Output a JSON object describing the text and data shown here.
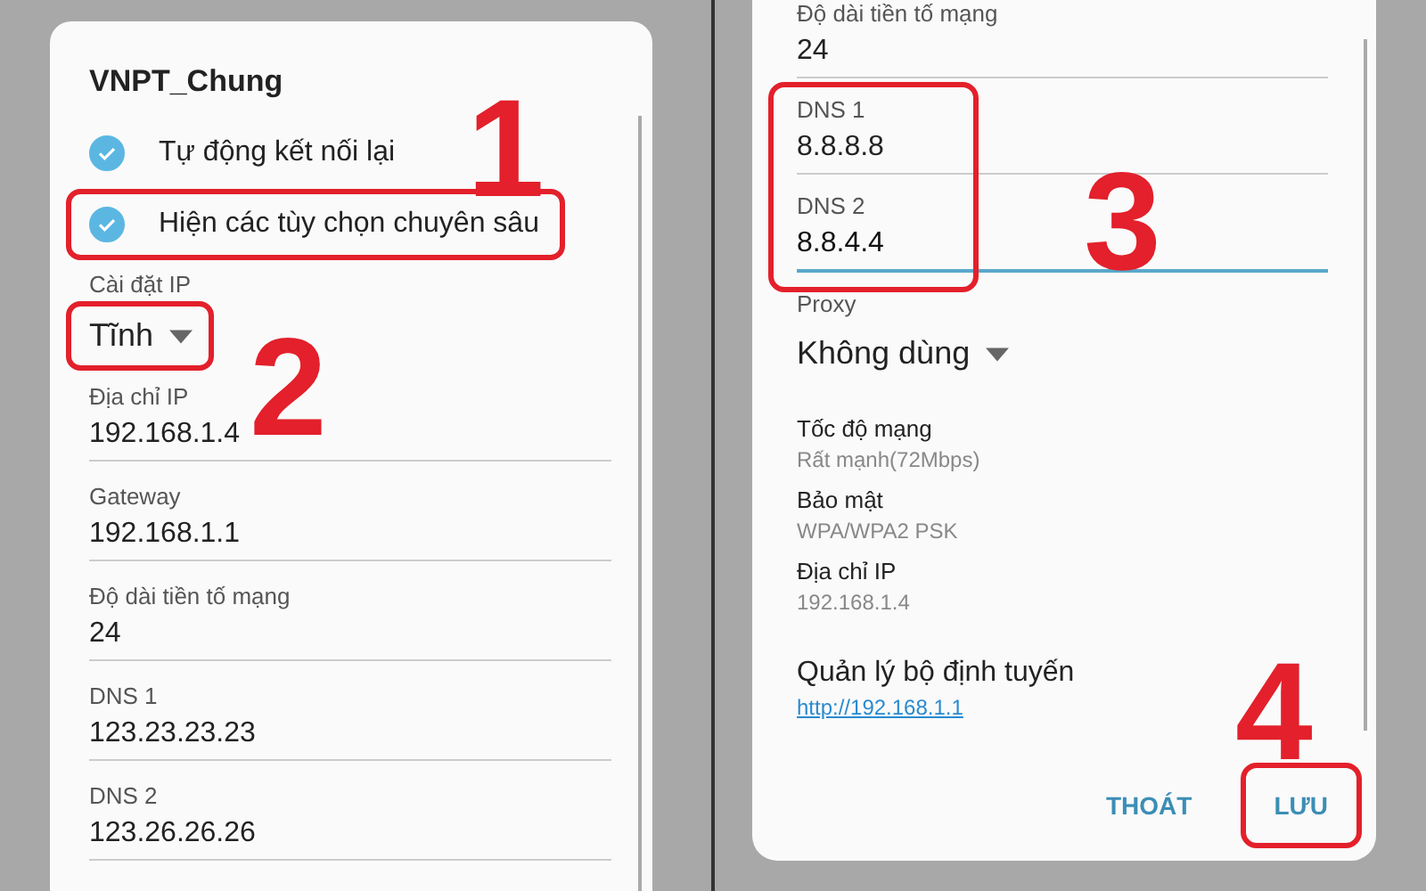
{
  "left_dialog": {
    "title": "VNPT_Chung",
    "checkboxes": [
      {
        "label": "Tự động kết nối lại",
        "checked": true,
        "highlighted": false
      },
      {
        "label": "Hiện các tùy chọn chuyên sâu",
        "checked": true,
        "highlighted": true
      }
    ],
    "ip_setting": {
      "label": "Cài đặt IP",
      "value": "Tĩnh",
      "highlighted": true
    },
    "fields": [
      {
        "label": "Địa chỉ IP",
        "value": "192.168.1.4"
      },
      {
        "label": "Gateway",
        "value": "192.168.1.1"
      },
      {
        "label": "Độ dài tiền tố mạng",
        "value": "24"
      },
      {
        "label": "DNS 1",
        "value": "123.23.23.23"
      },
      {
        "label": "DNS 2",
        "value": "123.26.26.26"
      }
    ]
  },
  "right_dialog": {
    "fields": [
      {
        "label": "Độ dài tiền tố mạng",
        "value": "24"
      }
    ],
    "dns_group": {
      "highlighted": true,
      "fields": [
        {
          "label": "DNS 1",
          "value": "8.8.8.8",
          "focused": false
        },
        {
          "label": "DNS 2",
          "value": "8.8.4.4",
          "focused": true
        }
      ]
    },
    "proxy": {
      "label": "Proxy",
      "value": "Không dùng"
    },
    "info": [
      {
        "label": "Tốc độ mạng",
        "value": "Rất mạnh(72Mbps)"
      },
      {
        "label": "Bảo mật",
        "value": "WPA/WPA2 PSK"
      },
      {
        "label": "Địa chỉ IP",
        "value": "192.168.1.4"
      }
    ],
    "router": {
      "title": "Quản lý bộ định tuyến",
      "link": "http://192.168.1.1"
    },
    "buttons": [
      {
        "label": "THOÁT",
        "highlighted": false
      },
      {
        "label": "LƯU",
        "highlighted": true
      }
    ]
  },
  "annotations": [
    "1",
    "2",
    "3",
    "4"
  ]
}
